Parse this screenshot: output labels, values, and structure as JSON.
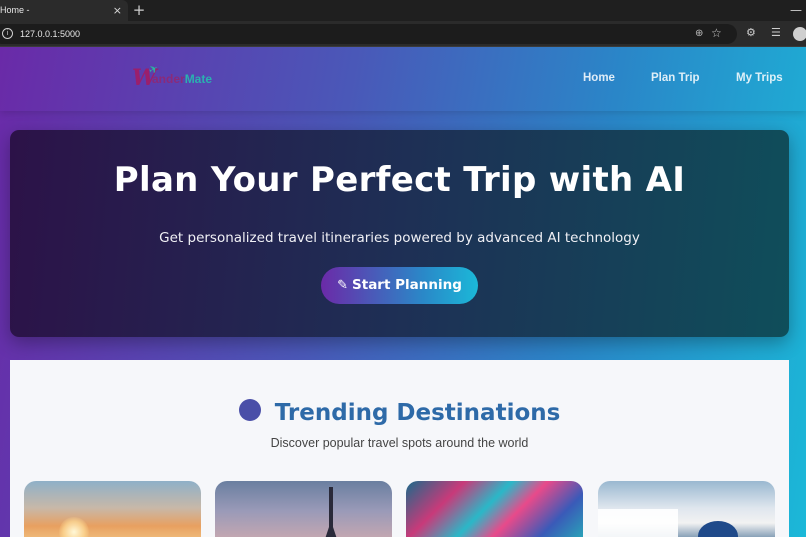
{
  "browser": {
    "tab_title": "Home -",
    "tab_close": "×",
    "new_tab": "+",
    "minimize": "—",
    "url": "127.0.0.1:5000"
  },
  "nav": {
    "logo_w": "W",
    "logo_a": "ander",
    "logo_b": "Mate",
    "links": [
      "Home",
      "Plan Trip",
      "My Trips"
    ]
  },
  "hero": {
    "title": "Plan Your Perfect Trip with AI",
    "subtitle": "Get personalized travel itineraries powered by advanced AI technology",
    "cta_label": "Start Planning"
  },
  "trending": {
    "title": "Trending Destinations",
    "subtitle": "Discover popular travel spots around the world"
  },
  "colors": {
    "accent_purple": "#6a2aa8",
    "accent_cyan": "#1bb8d8",
    "section_title": "#2e6aa8"
  },
  "icons": {
    "info": "info-icon",
    "pencil": "pencil-icon",
    "globe": "globe-icon"
  }
}
